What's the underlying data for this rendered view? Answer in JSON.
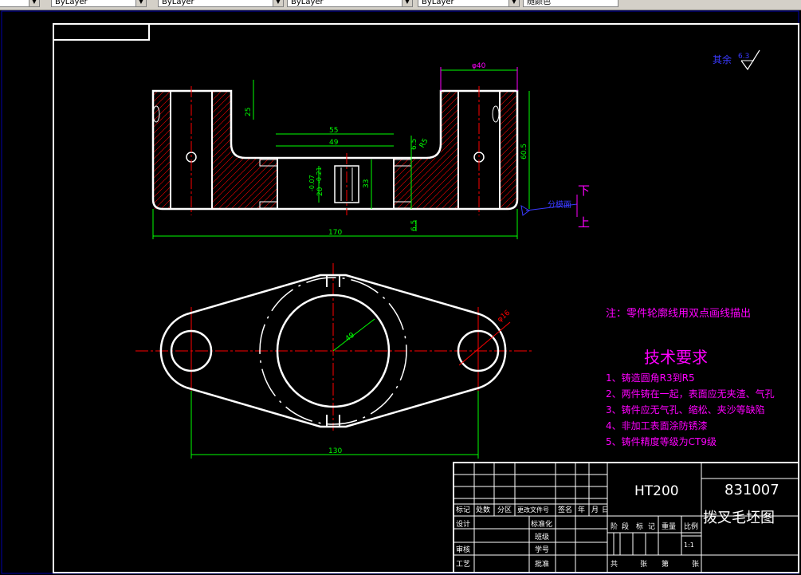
{
  "toolbar": {
    "combos": [
      "",
      "ByLayer",
      "ByLayer",
      "ByLayer",
      "随颜色"
    ]
  },
  "drawing": {
    "dims": {
      "d40": "φ40",
      "d25": "25",
      "d55": "55",
      "d49": "49",
      "d6_5a": "6.5",
      "d60_5": "60.5",
      "d33": "33",
      "d20tol_main": "20",
      "d20tol_dev": "-0.07",
      "d20tol_dev2": "-0.21",
      "d6_5b": "6.5",
      "d170": "170",
      "d130": "130",
      "d49b": "49",
      "d16": "φ16",
      "r5": "R5"
    },
    "parting_label": "分模面",
    "up": "上",
    "down": "下",
    "surface_note": "其余",
    "surface_value": "6.3",
    "outline_note": "注：零件轮廓线用双点画线描出",
    "tech_title": "技术要求",
    "tech_items": [
      "1、铸造圆角R3到R5",
      "2、两件铸在一起，表面应无夹渣、气孔",
      "3、铸件应无气孔、缩松、夹沙等缺陷",
      "4、非加工表面涂防锈漆",
      "5、铸件精度等级为CT9级"
    ]
  },
  "titleblock": {
    "material": "HT200",
    "code": "831007",
    "name": "拨叉毛坯图",
    "hdr": [
      "标记",
      "处数",
      "分区",
      "更改文件号",
      "签名",
      "年",
      "月",
      "日"
    ],
    "rows_left": [
      "设计",
      "",
      "审核",
      "工艺"
    ],
    "rows_mid": [
      "标准化",
      "班级",
      "学号",
      "批准"
    ],
    "stage": [
      "阶",
      "段",
      "标",
      "记"
    ],
    "weight": "重量",
    "scale_lbl": "比例",
    "scale": "1:1",
    "sheets": [
      "共",
      "张",
      "第",
      "张"
    ]
  },
  "colors": {
    "line": "#ffffff",
    "dim": "#00ff00",
    "center": "#ff0000",
    "note": "#ff00ff",
    "blue": "#3a3aff",
    "frame_blue": "#0000aa"
  }
}
